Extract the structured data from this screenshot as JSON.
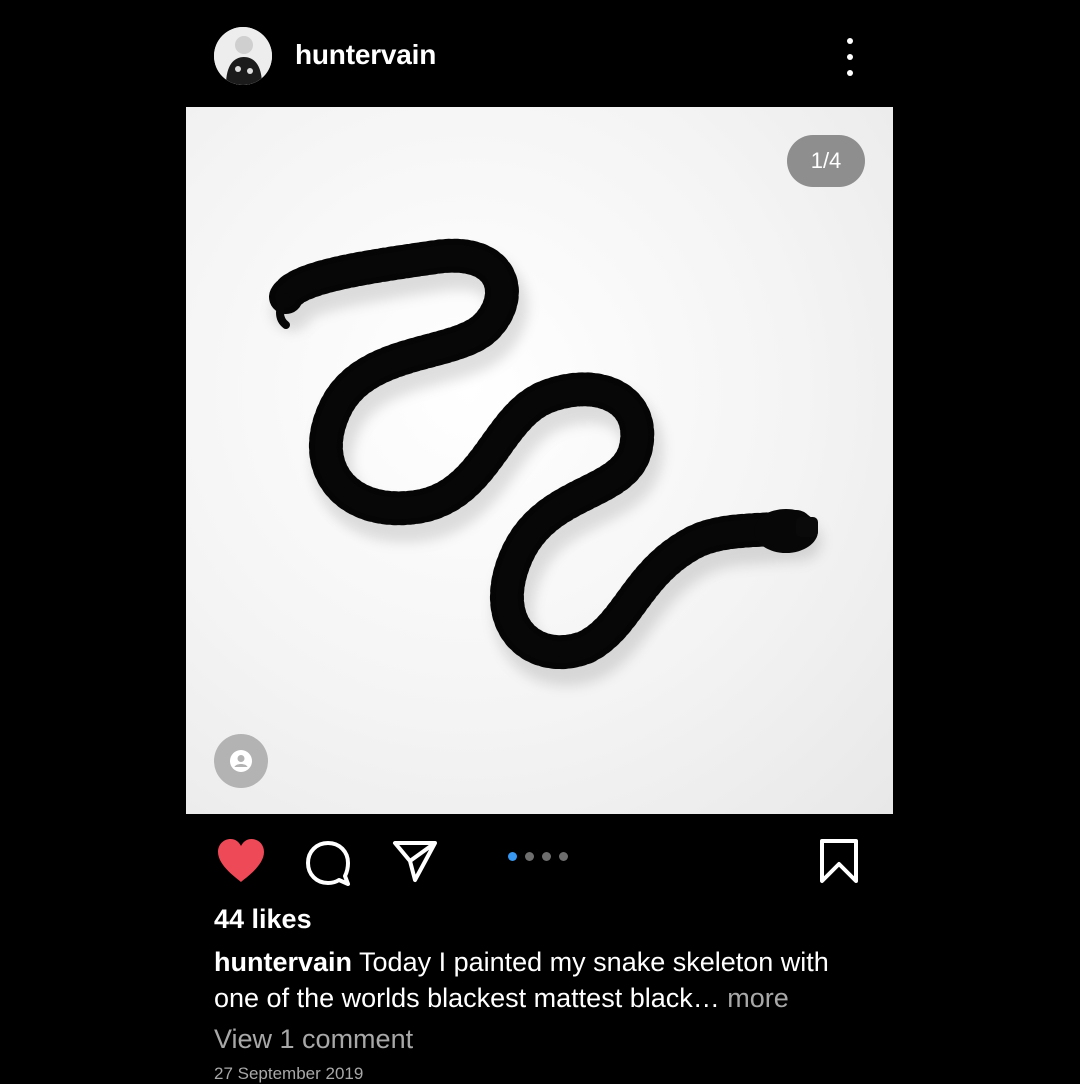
{
  "post": {
    "username": "huntervain",
    "image_counter": "1/4",
    "carousel": {
      "count": 4,
      "active": 1
    },
    "likes": "44 likes",
    "caption": {
      "username": "huntervain",
      "text": " Today I painted my snake skeleton with one of the worlds blackest mattest black…",
      "more": " more"
    },
    "view_comments": "View 1 comment",
    "date": "27 September 2019"
  },
  "icons": {
    "like": "heart-filled-icon",
    "comment": "comment-icon",
    "share": "send-icon",
    "save": "bookmark-icon",
    "menu": "more-vertical-icon",
    "tags": "user-tag-icon"
  },
  "colors": {
    "background": "#000000",
    "like": "#ed4956",
    "active_dot": "#3897f0",
    "secondary_text": "#a8a8a8"
  }
}
